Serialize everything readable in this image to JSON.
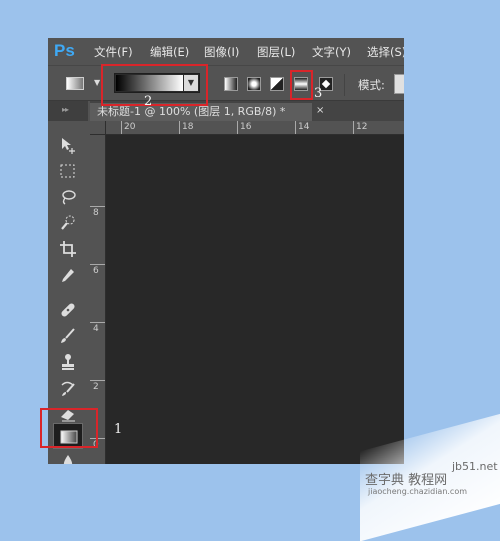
{
  "app": {
    "logo": "Ps"
  },
  "menu": [
    "文件(F)",
    "编辑(E)",
    "图像(I)",
    "图层(L)",
    "文字(Y)",
    "选择(S)"
  ],
  "options_bar": {
    "mode_label": "模式:",
    "gradient_types": [
      "linear-gradient-icon",
      "radial-gradient-icon",
      "angle-gradient-icon",
      "reflected-gradient-icon",
      "diamond-gradient-icon"
    ]
  },
  "document_tab": {
    "title": "未标题-1 @ 100% (图层 1, RGB/8) *",
    "close": "×"
  },
  "rulers": {
    "top": [
      "20",
      "18",
      "16",
      "14",
      "12"
    ],
    "left": [
      "8",
      "6",
      "4",
      "2",
      "0",
      "2"
    ]
  },
  "annotations": [
    "1",
    "2",
    "3"
  ],
  "annotation_color": "#d9252a",
  "watermark": {
    "line1": "jb51.net",
    "line2": "查字典 教程网",
    "line3": "jiaocheng.chazidian.com"
  }
}
